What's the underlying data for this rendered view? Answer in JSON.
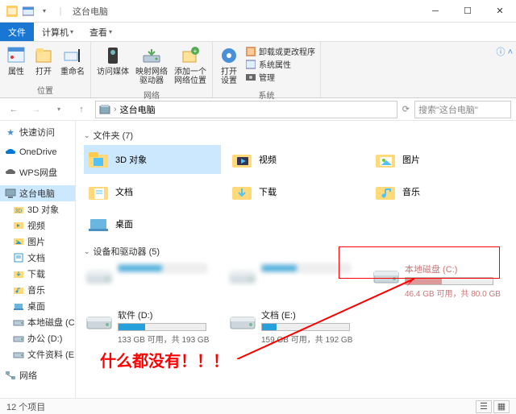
{
  "title": "这台电脑",
  "menubar": {
    "file": "文件",
    "computer": "计算机",
    "view": "查看"
  },
  "ribbon": {
    "location": {
      "properties": "属性",
      "open": "打开",
      "rename": "重命名",
      "group": "位置"
    },
    "network": {
      "media": "访问媒体",
      "mapdrive": "映射网络\n驱动器",
      "addloc": "添加一个\n网络位置",
      "group": "网络"
    },
    "system": {
      "settings": "打开\n设置",
      "uninstall": "卸载或更改程序",
      "sysprops": "系统属性",
      "manage": "管理",
      "group": "系统"
    }
  },
  "address": {
    "path": "这台电脑",
    "search_placeholder": "搜索\"这台电脑\""
  },
  "sidebar": {
    "quickaccess": "快速访问",
    "onedrive": "OneDrive",
    "wps": "WPS网盘",
    "thispc": "这台电脑",
    "items": [
      "3D 对象",
      "视频",
      "图片",
      "文档",
      "下载",
      "音乐",
      "桌面",
      "本地磁盘 (C:)",
      "办公 (D:)",
      "文件资料 (E:)"
    ],
    "network": "网络"
  },
  "content": {
    "folders_hdr": "文件夹 (7)",
    "folders": [
      "3D 对象",
      "视频",
      "图片",
      "文档",
      "下载",
      "音乐",
      "桌面"
    ],
    "drives_hdr": "设备和驱动器 (5)",
    "drives": [
      {
        "name": "本地磁盘 (C:)",
        "free": "46.4 GB 可用，共 80.0 GB",
        "pct": 42,
        "blur": false,
        "dim": true
      },
      {
        "name": "软件 (D:)",
        "free": "133 GB 可用，共 193 GB",
        "pct": 31,
        "blur": false
      },
      {
        "name": "文档 (E:)",
        "free": "159 GB 可用，共 192 GB",
        "pct": 17,
        "blur": false
      }
    ]
  },
  "annotation": "什么都没有！！！",
  "status": "12 个项目"
}
